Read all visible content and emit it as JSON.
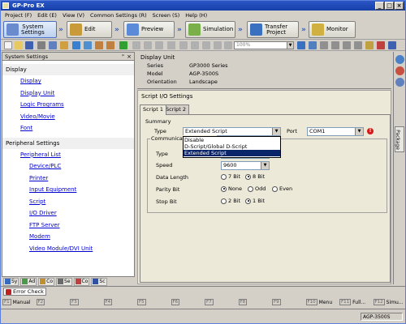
{
  "window": {
    "title": "GP-Pro EX"
  },
  "menu": [
    "Project (F)",
    "Edit (E)",
    "View (V)",
    "Common Settings (R)",
    "Screen (S)",
    "Help (H)"
  ],
  "workflow": [
    {
      "label": "System\nSettings",
      "icon": "system-settings-icon",
      "color": "#6a8ccf",
      "active": true
    },
    {
      "label": "Edit",
      "icon": "edit-icon",
      "color": "#c89a3a"
    },
    {
      "label": "Preview",
      "icon": "preview-icon",
      "color": "#5a8ad8"
    },
    {
      "label": "Simulation",
      "icon": "simulation-icon",
      "color": "#7ab04a"
    },
    {
      "label": "Transfer\nProject",
      "icon": "transfer-project-icon",
      "color": "#3a70c0"
    },
    {
      "label": "Monitor",
      "icon": "monitor-icon",
      "color": "#d0b040"
    }
  ],
  "toolbar": {
    "zoom": "100%"
  },
  "left": {
    "header": "System Settings",
    "display_section": "Display",
    "display_links": [
      "Display",
      "Display Unit",
      "Logic Programs",
      "Video/Movie",
      "Font"
    ],
    "peripheral_section": "Peripheral Settings",
    "peripheral_list": "Peripheral List",
    "peripheral_links": [
      "Device/PLC",
      "Printer",
      "Input Equipment",
      "Script",
      "I/O Driver",
      "FTP Server",
      "Modem",
      "Video Module/DVI Unit"
    ],
    "bottom_tabs": [
      {
        "label": "Sy",
        "color": "#3a6ac0"
      },
      {
        "label": "Ad",
        "color": "#4a9a4a"
      },
      {
        "label": "Co",
        "color": "#c09030"
      },
      {
        "label": "Se",
        "color": "#6a6a6a"
      },
      {
        "label": "Co",
        "color": "#c04040"
      },
      {
        "label": "Sc",
        "color": "#3050a0"
      }
    ]
  },
  "display_unit": {
    "title": "Display Unit",
    "rows": [
      {
        "key": "Series",
        "value": "GP3000 Series"
      },
      {
        "key": "Model",
        "value": "AGP-3500S"
      },
      {
        "key": "Orientation",
        "value": "Landscape"
      }
    ]
  },
  "script_io": {
    "title": "Script I/O Settings",
    "tabs": [
      "Script 1",
      "Script 2"
    ],
    "summary": "Summary",
    "type_label": "Type",
    "type_value": "Extended Script",
    "type_options": [
      "Disable",
      "D-Script/Global D-Script",
      "Extended Script"
    ],
    "port_label": "Port",
    "port_value": "COM1",
    "comm_group": "Communication Settings",
    "comm_type_label": "Type",
    "speed_label": "Speed",
    "speed_value": "9600",
    "data_length_label": "Data Length",
    "data_length_options": [
      "7 Bit",
      "8 Bit"
    ],
    "data_length_selected": 1,
    "parity_label": "Parity Bit",
    "parity_options": [
      "None",
      "Odd",
      "Even"
    ],
    "parity_selected": 0,
    "stop_label": "Stop Bit",
    "stop_options": [
      "2 Bit",
      "1 Bit"
    ],
    "stop_selected": 1
  },
  "right_sidebar": {
    "tab": "Package"
  },
  "error_tab": "Error Check",
  "function_keys": [
    {
      "key": "F1",
      "label": "Manual"
    },
    {
      "key": "F2",
      "label": ""
    },
    {
      "key": "F3",
      "label": ""
    },
    {
      "key": "F4",
      "label": ""
    },
    {
      "key": "F5",
      "label": ""
    },
    {
      "key": "F6",
      "label": ""
    },
    {
      "key": "F7",
      "label": ""
    },
    {
      "key": "F8",
      "label": ""
    },
    {
      "key": "F9",
      "label": ""
    },
    {
      "key": "F10",
      "label": "Menu"
    },
    {
      "key": "F11",
      "label": "Full..."
    },
    {
      "key": "F12",
      "label": "Simu..."
    }
  ],
  "status": {
    "model": "AGP-3500S"
  }
}
